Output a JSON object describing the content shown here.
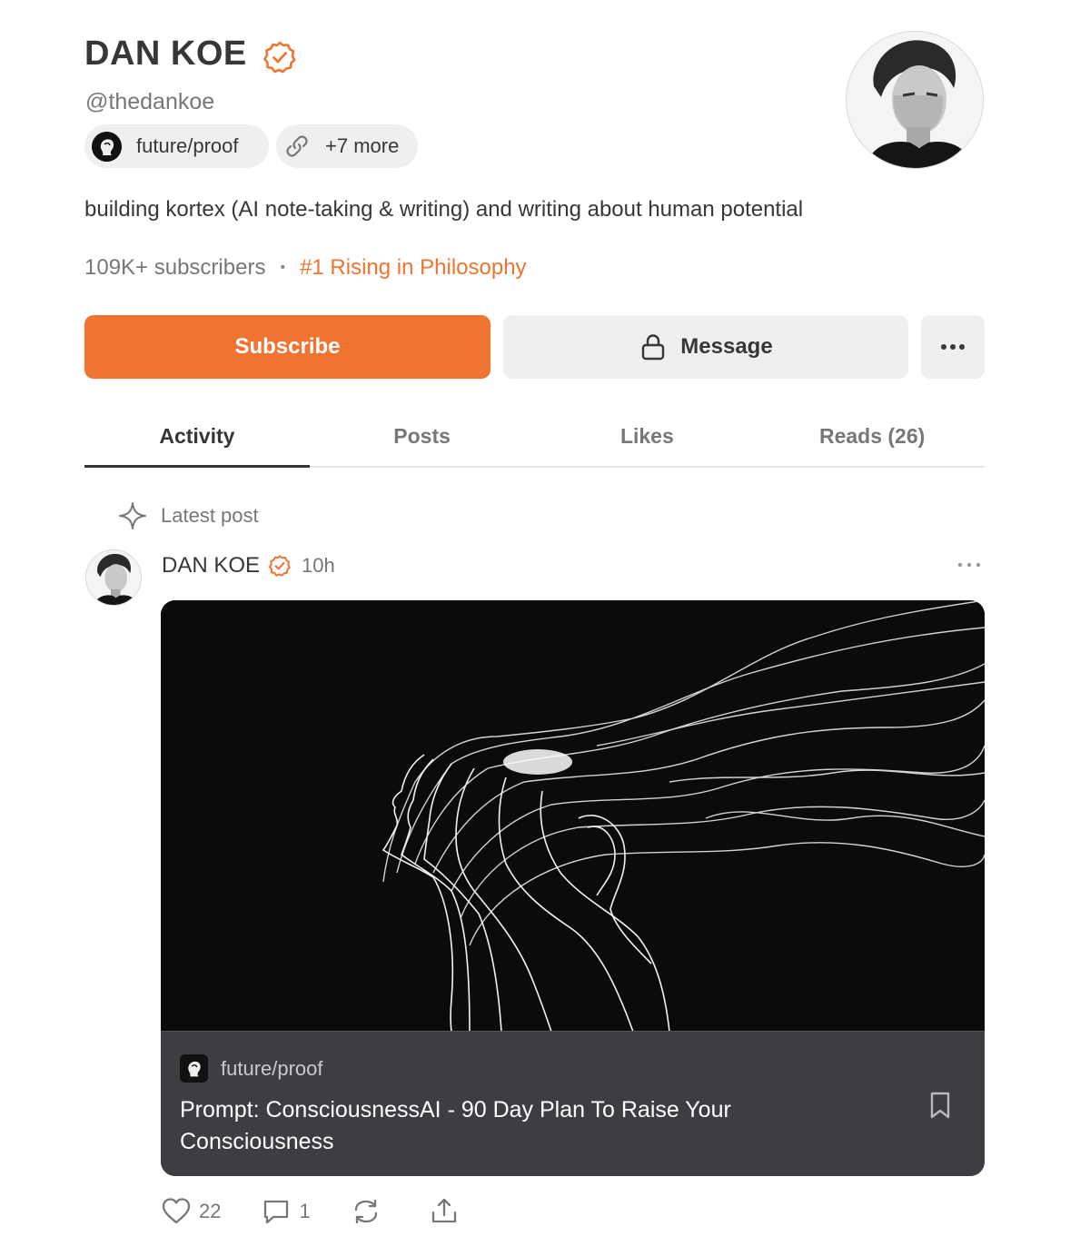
{
  "profile": {
    "name": "DAN KOE",
    "handle": "@thedankoe",
    "bio": "building kortex (AI note-taking & writing) and writing about human potential",
    "subscribers": "109K+ subscribers",
    "separator": "•",
    "rank": "#1 Rising in Philosophy",
    "chips": {
      "publication": "future/proof",
      "more_links": "+7 more"
    }
  },
  "buttons": {
    "subscribe": "Subscribe",
    "message": "Message"
  },
  "tabs": [
    {
      "label": "Activity",
      "active": true
    },
    {
      "label": "Posts",
      "active": false
    },
    {
      "label": "Likes",
      "active": false
    },
    {
      "label": "Reads (26)",
      "active": false
    }
  ],
  "feed": {
    "section_label": "Latest post",
    "post": {
      "author": "DAN KOE",
      "time": "10h",
      "publication": "future/proof",
      "title": "Prompt: ConsciousnessAI - 90 Day Plan To Raise Your Consciousness",
      "likes": "22",
      "comments": "1"
    }
  },
  "icons": {
    "verified": "verified-check-icon",
    "link": "link-icon",
    "lock": "lock-icon",
    "more": "more-horizontal-icon",
    "sparkle": "sparkle-icon",
    "bookmark": "bookmark-icon",
    "heart": "heart-icon",
    "comment": "comment-icon",
    "restack": "restack-icon",
    "share": "share-icon"
  },
  "colors": {
    "accent": "#ef7432",
    "text": "#363737",
    "muted": "#777777",
    "button_bg": "#efefef",
    "card_bg": "#3d3d42"
  }
}
